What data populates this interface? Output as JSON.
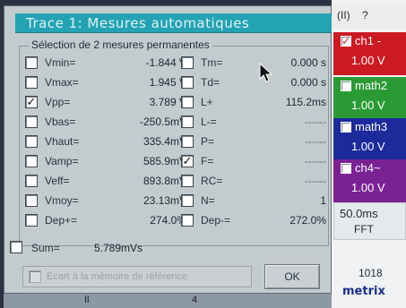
{
  "dialog": {
    "title": "Trace 1: Mesures automatiques",
    "group_title": "Sélection de 2 mesures permanentes",
    "left_measures": [
      {
        "label": "Vmin=",
        "value": "-1.844 V",
        "checked": false
      },
      {
        "label": "Vmax=",
        "value": "1.945 V",
        "checked": false
      },
      {
        "label": "Vpp=",
        "value": "3.789 V",
        "checked": true
      },
      {
        "label": "Vbas=",
        "value": "-250.5mV",
        "checked": false
      },
      {
        "label": "Vhaut=",
        "value": "335.4mV",
        "checked": false
      },
      {
        "label": "Vamp=",
        "value": "585.9mV",
        "checked": false
      },
      {
        "label": "Veff=",
        "value": "893.8mV",
        "checked": false
      },
      {
        "label": "Vmoy=",
        "value": "23.13mV",
        "checked": false
      },
      {
        "label": "Dep+=",
        "value": "274.0%",
        "checked": false
      }
    ],
    "right_measures": [
      {
        "label": "Tm=",
        "value": "0.000 s",
        "checked": false
      },
      {
        "label": "Td=",
        "value": "0.000 s",
        "checked": false
      },
      {
        "label": "L+",
        "value": "115.2ms",
        "checked": false
      },
      {
        "label": "L-=",
        "value": "------",
        "checked": false
      },
      {
        "label": "P=",
        "value": "------",
        "checked": false
      },
      {
        "label": "F=",
        "value": "------",
        "checked": true
      },
      {
        "label": "RC=",
        "value": "------",
        "checked": false
      },
      {
        "label": "N=",
        "value": "1",
        "checked": false
      },
      {
        "label": "Dep-=",
        "value": "272.0%",
        "checked": false
      }
    ],
    "sum": {
      "label": "Sum=",
      "value": "5.789mVs"
    },
    "ecart_label": "Ecart à la mémoire de référence",
    "ok_label": "OK"
  },
  "right_panel": {
    "menu_left": "(II)",
    "menu_right": "?",
    "channels": [
      {
        "name": "ch1 -",
        "volts": "1.00 V",
        "checked": true
      },
      {
        "name": "math2",
        "volts": "1.00 V",
        "checked": false
      },
      {
        "name": "math3",
        "volts": "1.00 V",
        "checked": false
      },
      {
        "name": "ch4~",
        "volts": "1.00 V",
        "checked": false
      }
    ],
    "timebase": "50.0ms",
    "fft_label": "FFT",
    "counter": "1018",
    "brand": "metrix"
  },
  "bottom_bar": {
    "marker_left": "Il",
    "marker_mid": "4"
  },
  "colors": {
    "title_bar": "#24a3b4",
    "ch1": "#cc1a22",
    "math2": "#2a9b34",
    "math3": "#1d2a9a",
    "ch4": "#7a2293",
    "brand": "#1d2f86"
  },
  "icons": {
    "cursor": "arrow-pointer-icon"
  }
}
